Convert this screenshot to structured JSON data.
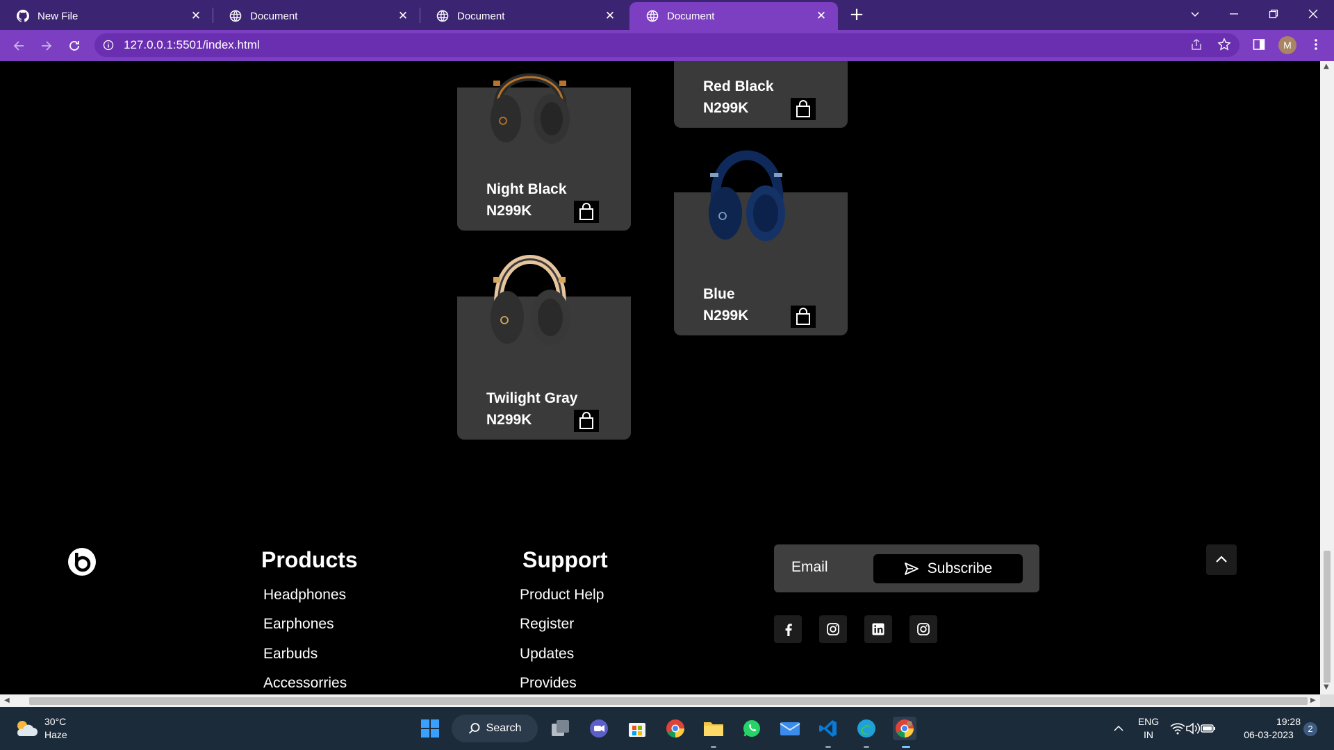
{
  "browser": {
    "tabs": [
      {
        "title": "New File",
        "icon": "github-icon",
        "active": false
      },
      {
        "title": "Document",
        "icon": "globe-icon",
        "active": false
      },
      {
        "title": "Document",
        "icon": "globe-icon",
        "active": false
      },
      {
        "title": "Document",
        "icon": "globe-icon",
        "active": true
      }
    ],
    "url": "127.0.0.1:5501/index.html",
    "profile_initial": "M",
    "colors": {
      "tabbar": "#3b2573",
      "active_tab": "#7d3fc2"
    }
  },
  "products": [
    {
      "name": "Night Black",
      "price": "N299K",
      "color": "#2e2e2e",
      "accent": "#b8742a"
    },
    {
      "name": "Red Black",
      "price": "N299K",
      "color": "#2e2e2e",
      "accent": "#b81f1f"
    },
    {
      "name": "Blue",
      "price": "N299K",
      "color": "#0f2a5a",
      "accent": "#7fa0c0"
    },
    {
      "name": "Twilight Gray",
      "price": "N299K",
      "color": "#333333",
      "accent": "#e6c59e"
    }
  ],
  "footer": {
    "logo_icon": "beats-logo-icon",
    "products_title": "Products",
    "products_links": [
      "Headphones",
      "Earphones",
      "Earbuds",
      "Accessorries"
    ],
    "support_title": "Support",
    "support_links": [
      "Product Help",
      "Register",
      "Updates",
      "Provides"
    ],
    "email_label": "Email",
    "subscribe_label": "Subscribe",
    "social_icons": [
      "facebook-icon",
      "instagram-icon",
      "linkedin-icon",
      "instagram-icon"
    ]
  },
  "taskbar": {
    "weather_temp": "30°C",
    "weather_desc": "Haze",
    "search_label": "Search",
    "lang_line1": "ENG",
    "lang_line2": "IN",
    "time": "19:28",
    "date": "06-03-2023",
    "notification_count": "2"
  }
}
